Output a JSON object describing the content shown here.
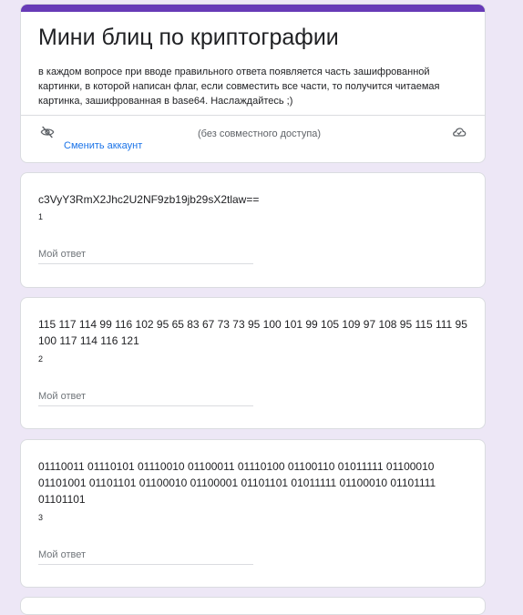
{
  "form": {
    "title": "Мини блиц по криптографии",
    "description": "в каждом вопросе при вводе правильного ответа появляется часть зашифрованной картинки, в которой написан флаг, если совместить все части, то получится читаемая картинка, зашифрованная в base64. Наслаждайтесь ;)",
    "account_status": "(без совместного доступа)",
    "switch_account": "Сменить аккаунт",
    "accent_color": "#673ab7"
  },
  "questions": [
    {
      "text": "c3VyY3RmX2Jhc2U2NF9zb19jb29sX2tlaw==",
      "number": "1",
      "placeholder": "Мой ответ"
    },
    {
      "text": "115 117 114 99 116 102 95 65 83 67 73 73 95 100 101 99 105 109 97 108 95 115 111 95 100 117 114 116 121",
      "number": "2",
      "placeholder": "Мой ответ"
    },
    {
      "text": "01110011 01110101 01110010 01100011 01110100 01100110 01011111 01100010 01101001 01101101 01100010 01100001 01101101 01011111 01100010 01101111 01101101",
      "number": "3",
      "placeholder": "Мой ответ"
    }
  ]
}
